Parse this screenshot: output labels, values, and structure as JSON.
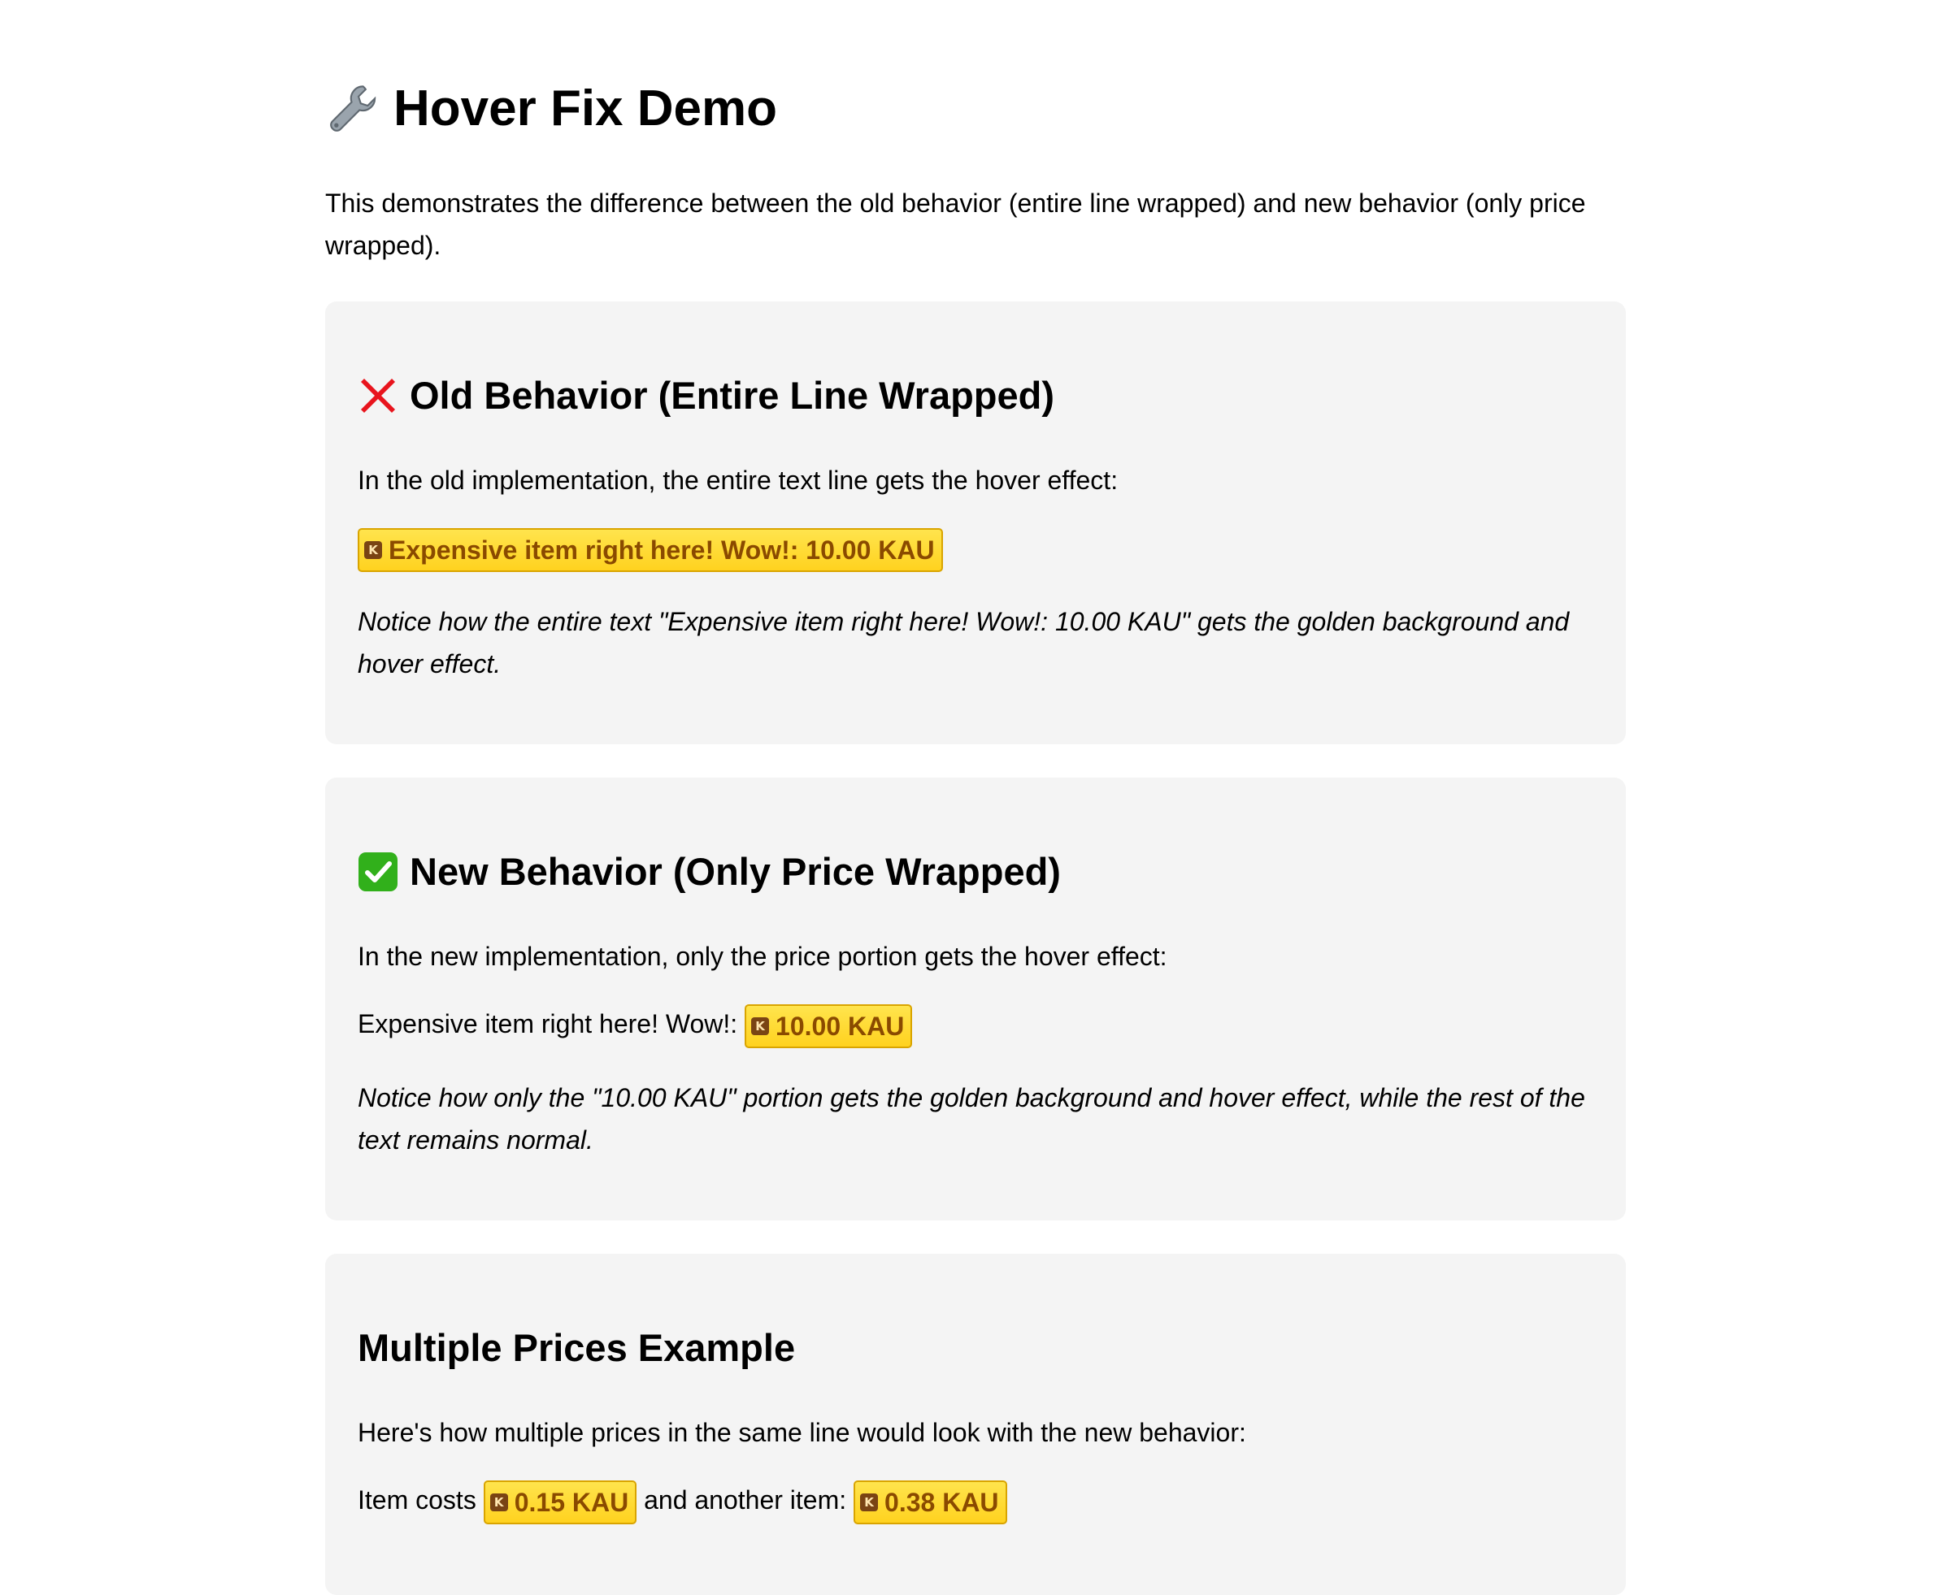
{
  "page": {
    "title": "Hover Fix Demo",
    "title_icon": "wrench-icon",
    "intro": "This demonstrates the difference between the old behavior (entire line wrapped) and new behavior (only price wrapped)."
  },
  "colors": {
    "price_bg": "#ffd21f",
    "price_border": "#d9a400",
    "price_text": "#8a4a00",
    "section_bg": "#f4f4f4",
    "cross": "#e8141d",
    "check": "#31b01b"
  },
  "old_section": {
    "icon": "red-cross-icon",
    "heading": "Old Behavior (Entire Line Wrapped)",
    "description": "In the old implementation, the entire text line gets the hover effect:",
    "price_line": "Expensive item right here! Wow!: 10.00 KAU",
    "note": "Notice how the entire text \"Expensive item right here! Wow!: 10.00 KAU\" gets the golden background and hover effect."
  },
  "new_section": {
    "icon": "green-check-icon",
    "heading": "New Behavior (Only Price Wrapped)",
    "description": "In the new implementation, only the price portion gets the hover effect:",
    "item_text": "Expensive item right here! Wow!:",
    "price": "10.00 KAU",
    "note": "Notice how only the \"10.00 KAU\" portion gets the golden background and hover effect, while the rest of the text remains normal."
  },
  "multi_section": {
    "heading": "Multiple Prices Example",
    "description": "Here's how multiple prices in the same line would look with the new behavior:",
    "text_before": "Item costs",
    "price_1": "0.15 KAU",
    "text_between": "and another item:",
    "price_2": "0.38 KAU"
  },
  "k_icon_letter": "K"
}
